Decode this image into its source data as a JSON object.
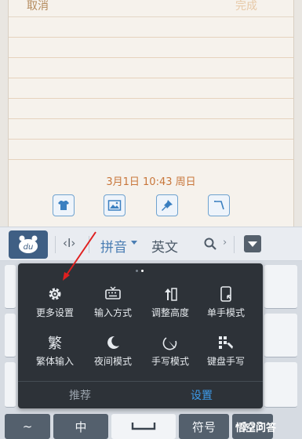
{
  "editor": {
    "cancel_label": "取消",
    "done_label": "完成",
    "timestamp": "3月1日 10:43 周日",
    "tools": [
      {
        "icon": "shirt-icon"
      },
      {
        "icon": "image-icon"
      },
      {
        "icon": "pin-icon"
      },
      {
        "icon": "corner-icon"
      }
    ]
  },
  "keyboard_toolbar": {
    "logo_text": "du",
    "cursor_glyph": "‹I›",
    "pinyin_label": "拼音",
    "english_label": "英文",
    "more_arrow": "›"
  },
  "settings_popup": {
    "page_indicator": {
      "count": 2,
      "active_index": 1
    },
    "items": [
      {
        "label": "更多设置",
        "icon": "gear-icon"
      },
      {
        "label": "输入方式",
        "icon": "keyboard-icon"
      },
      {
        "label": "调整高度",
        "icon": "height-icon"
      },
      {
        "label": "单手模式",
        "icon": "one-hand-icon"
      },
      {
        "label": "繁体输入",
        "icon": "traditional-char-icon"
      },
      {
        "label": "夜间模式",
        "icon": "moon-icon"
      },
      {
        "label": "手写模式",
        "icon": "handwriting-icon"
      },
      {
        "label": "键盘手写",
        "icon": "keyboard-handwriting-icon"
      }
    ],
    "tabs": [
      {
        "label": "推荐",
        "active": false
      },
      {
        "label": "设置",
        "active": true
      }
    ]
  },
  "keyboard_bottom_row": {
    "tilde": "~",
    "chinese": "中",
    "symbols": "符号",
    "numbers": "123"
  },
  "watermark": "悟空问答",
  "colors": {
    "accent_blue": "#4a7db3",
    "tab_active": "#3d9be9",
    "popup_bg": "#2d3238",
    "timestamp": "#c8763a",
    "arrow": "#e02020"
  }
}
